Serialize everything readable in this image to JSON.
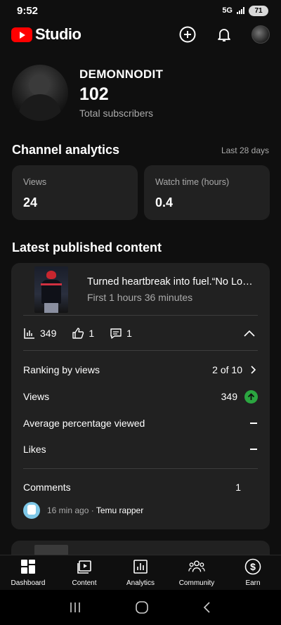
{
  "status_bar": {
    "time": "9:52",
    "network": "5G",
    "battery": "71"
  },
  "header": {
    "app_name": "Studio",
    "icons": [
      "create-icon",
      "notifications-icon",
      "account-avatar"
    ]
  },
  "channel": {
    "name": "DEMONNODIT",
    "subscribers": "102",
    "subscribers_label": "Total subscribers"
  },
  "analytics": {
    "title": "Channel analytics",
    "period": "Last 28 days",
    "cards": [
      {
        "label": "Views",
        "value": "24"
      },
      {
        "label": "Watch time (hours)",
        "value": "0.4"
      }
    ]
  },
  "latest": {
    "title": "Latest published content",
    "video_title": "Turned heartbreak into fuel.“No Lov…",
    "video_subtitle": "First 1 hours 36 minutes",
    "metrics": {
      "views": "349",
      "likes": "1",
      "comments": "1"
    },
    "rows": {
      "ranking_label": "Ranking by views",
      "ranking_value": "2 of 10",
      "views_label": "Views",
      "views_value": "349",
      "avg_pct_label": "Average percentage viewed",
      "likes_label": "Likes",
      "comments_label": "Comments",
      "comments_value": "1"
    },
    "comment": {
      "time": "16 min ago",
      "separator": "·",
      "author": "Temu rapper"
    }
  },
  "bottom_nav": [
    {
      "label": "Dashboard",
      "icon": "dashboard-icon"
    },
    {
      "label": "Content",
      "icon": "content-icon"
    },
    {
      "label": "Analytics",
      "icon": "analytics-icon"
    },
    {
      "label": "Community",
      "icon": "community-icon"
    },
    {
      "label": "Earn",
      "icon": "earn-icon"
    }
  ],
  "colors": {
    "accent_red": "#ff0000",
    "positive_green": "#2ba640",
    "card_bg": "#212121",
    "page_bg": "#0f0f0f"
  }
}
